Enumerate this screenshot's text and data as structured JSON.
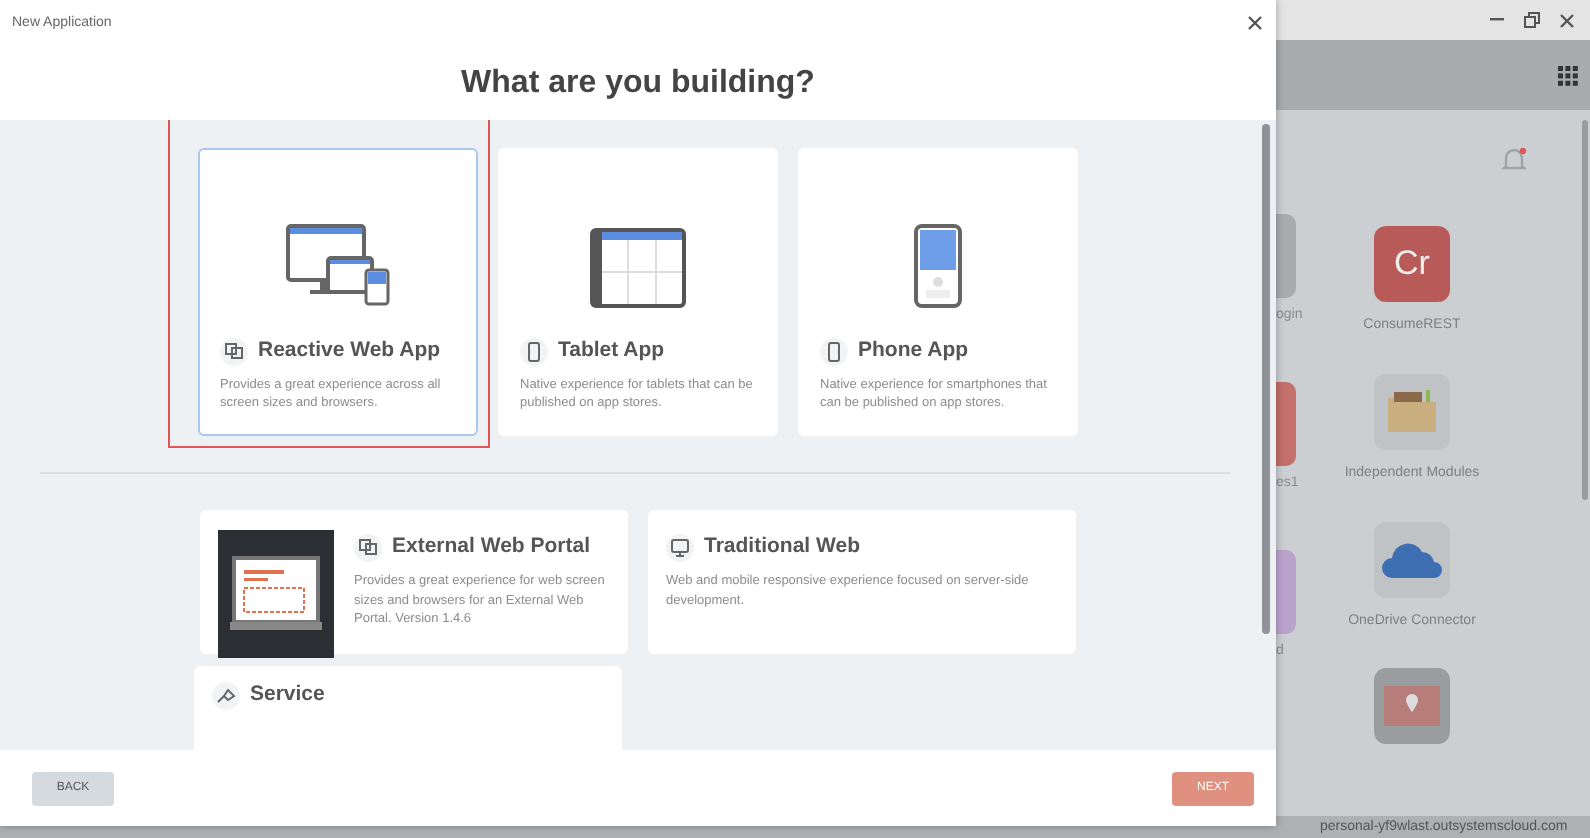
{
  "dialog": {
    "title": "New Application",
    "heading": "What are you building?",
    "options": [
      {
        "kind": "responsive",
        "title": "Reactive Web App",
        "description": "Provides a great experience across all screen sizes and browsers.",
        "selected": true,
        "highlighted": true
      },
      {
        "kind": "tablet",
        "title": "Tablet App",
        "description": "Native experience for tablets that can be published on app stores.",
        "selected": false,
        "highlighted": false
      },
      {
        "kind": "phone",
        "title": "Phone App",
        "description": "Native experience for smartphones that can be published on app stores.",
        "selected": false,
        "highlighted": false
      }
    ],
    "other_options": [
      {
        "kind": "portal",
        "title": "External Web Portal",
        "description": "Provides a great experience for web screen sizes and browsers for an External Web Portal. Version 1.4.6",
        "selected": false
      },
      {
        "kind": "web",
        "title": "Traditional Web",
        "description": "Web and mobile responsive experience focused on server-side development.",
        "selected": false
      },
      {
        "kind": "service",
        "title": "Service",
        "selected": false
      }
    ],
    "buttons": [
      {
        "kind": "secondary",
        "label": "BACK"
      },
      {
        "kind": "primary",
        "label": "NEXT"
      }
    ]
  },
  "background": {
    "partial_apps": [
      {
        "kind": "gray",
        "label": "ogin"
      },
      {
        "kind": "red",
        "label": "es1"
      },
      {
        "kind": "purple",
        "label": "d"
      }
    ],
    "apps": [
      {
        "kind": "letters",
        "letters": "Cr",
        "label": "ConsumeREST"
      },
      {
        "kind": "folder",
        "label": "Independent Modules"
      },
      {
        "kind": "cloud",
        "label": "OneDrive Connector"
      },
      {
        "kind": "map"
      }
    ],
    "status_bar": "personal-yf9wlast.outsystemscloud.com"
  }
}
